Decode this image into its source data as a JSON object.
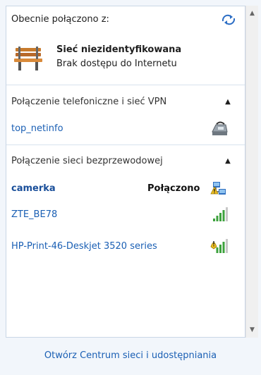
{
  "header": {
    "connected_label": "Obecnie połączono z:"
  },
  "current_network": {
    "name": "Sieć niezidentyfikowana",
    "status": "Brak dostępu do Internetu"
  },
  "sections": [
    {
      "title": "Połączenie telefoniczne i sieć VPN",
      "items": [
        {
          "label": "top_netinfo",
          "icon": "dialup-modem-icon"
        }
      ]
    },
    {
      "title": "Połączenie sieci bezprzewodowej",
      "items": [
        {
          "label": "camerka",
          "status": "Połączono",
          "icon": "wifi-shared-icon"
        },
        {
          "label": "ZTE_BE78",
          "icon": "wifi-signal-icon"
        },
        {
          "label": "HP-Print-46-Deskjet 3520 series",
          "icon": "wifi-unsecured-icon"
        }
      ]
    }
  ],
  "footer": {
    "link": "Otwórz Centrum sieci i udostępniania"
  },
  "colors": {
    "link": "#1a5fb4",
    "background": "#f2f6fb",
    "panel": "#ffffff"
  }
}
